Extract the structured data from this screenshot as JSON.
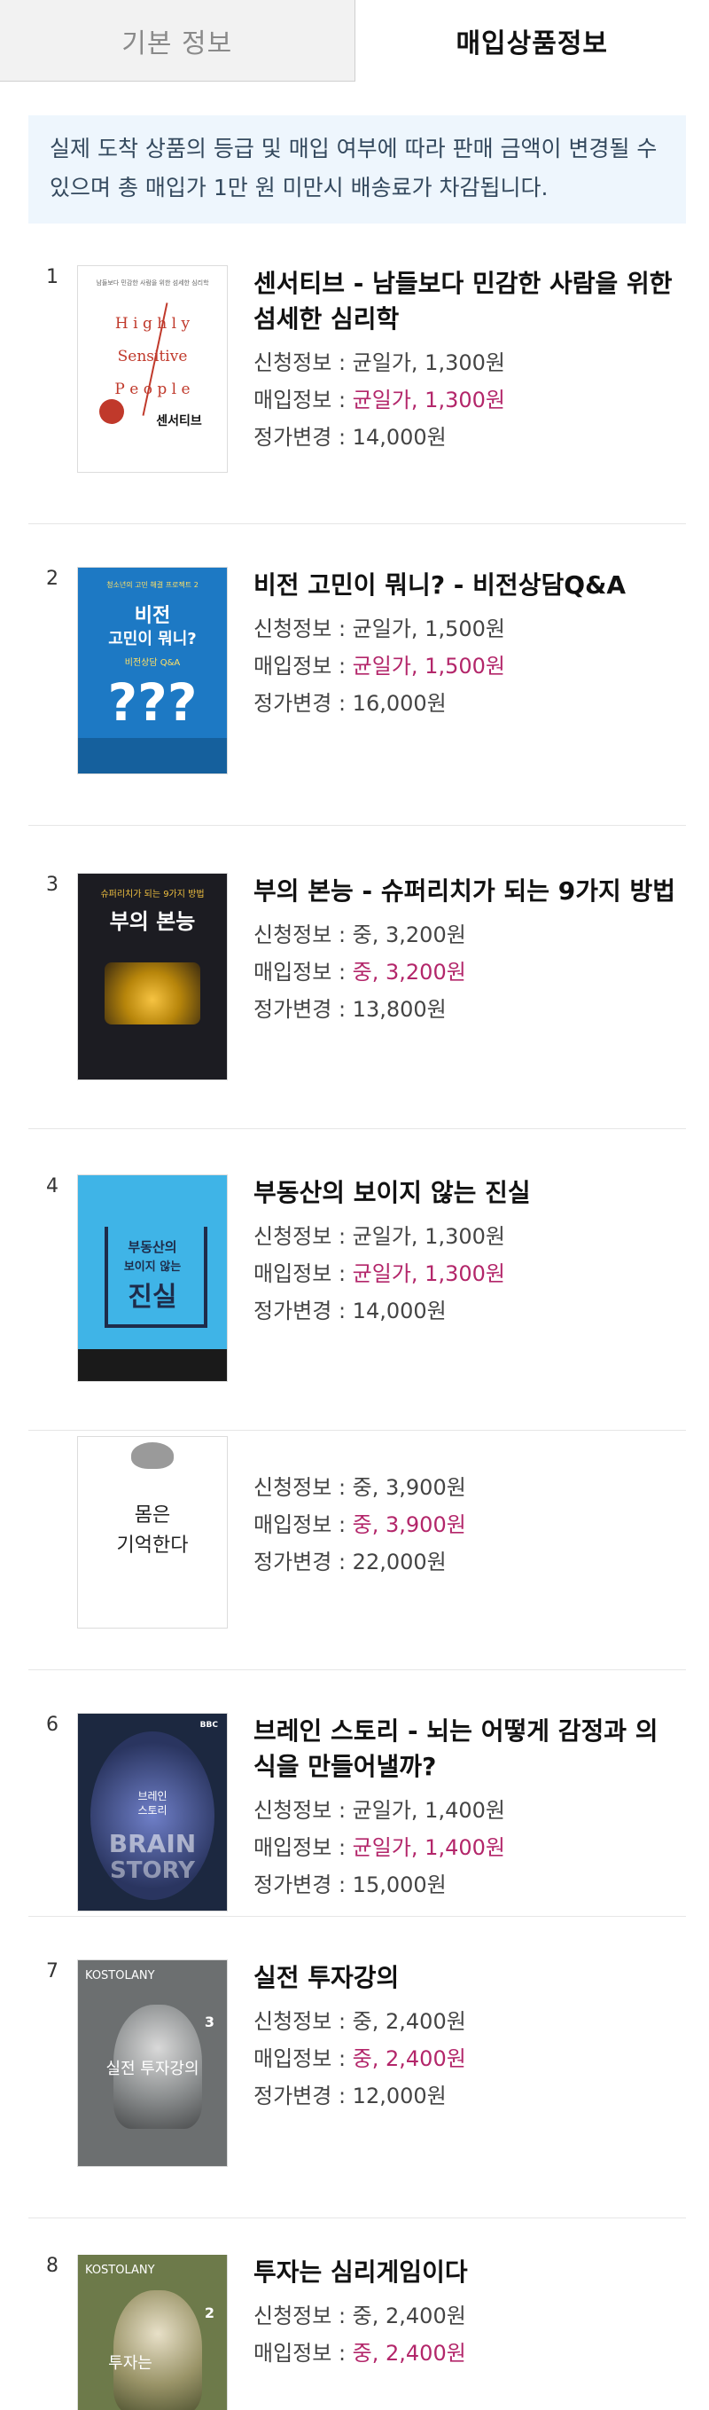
{
  "tabs": [
    {
      "label": "기본 정보"
    },
    {
      "label": "매입상품정보"
    }
  ],
  "notice": "실제 도착 상품의 등급 및 매입 여부에 따라 판매 금액이 변경될 수 있으며 총 매입가 1만 원 미만시 배송료가 차감됩니다.",
  "labels": {
    "request": "신청정보 : ",
    "purchase": "매입정보 : ",
    "price_change": "정가변경 : "
  },
  "items": [
    {
      "num": "1",
      "title": "센서티브 - 남들보다 민감한 사람을 위한 섬세한 심리학",
      "request": "균일가, 1,300원",
      "purchase": "균일가, 1,300원",
      "price": "14,000원",
      "cover": {
        "top": "남들보다 민감한 사람을 위한 섬세한 심리학",
        "lines": [
          "H i g h l y",
          "Sensitive",
          "P e o p l e"
        ],
        "name": "센서티브"
      }
    },
    {
      "num": "2",
      "title": "비전 고민이 뭐니? - 비전상담Q&A",
      "request": "균일가, 1,500원",
      "purchase": "균일가, 1,500원",
      "price": "16,000원",
      "cover": {
        "top": "청소년의 고민 해결 프로젝트 2",
        "lines": [
          "비전",
          "고민이 뭐니?"
        ],
        "name": "비전상담 Q&A"
      }
    },
    {
      "num": "3",
      "title": "부의 본능 - 슈퍼리치가 되는 9가지 방법",
      "request": "중, 3,200원",
      "purchase": "중, 3,200원",
      "price": "13,800원",
      "cover": {
        "top": "슈퍼리치가 되는 9가지 방법",
        "lines": [
          "부의 본능"
        ],
        "name": ""
      }
    },
    {
      "num": "4",
      "title": "부동산의 보이지 않는 진실",
      "request": "균일가, 1,300원",
      "purchase": "균일가, 1,300원",
      "price": "14,000원",
      "cover": {
        "top": "",
        "lines": [
          "부동산의",
          "보이지 않는",
          "진실"
        ],
        "name": ""
      }
    },
    {
      "num": "",
      "title": "",
      "request": "중, 3,900원",
      "purchase": "중, 3,900원",
      "price": "22,000원",
      "cover": {
        "top": "",
        "lines": [
          "몸은",
          "기억한다"
        ],
        "name": ""
      }
    },
    {
      "num": "6",
      "title": "브레인 스토리 - 뇌는 어떻게 감정과 의식을 만들어낼까?",
      "request": "균일가, 1,400원",
      "purchase": "균일가, 1,400원",
      "price": "15,000원",
      "cover": {
        "top": "BBC",
        "lines": [
          "브레인",
          "스토리",
          "BRAIN",
          "STORY"
        ],
        "name": ""
      }
    },
    {
      "num": "7",
      "title": "실전 투자강의",
      "request": "중, 2,400원",
      "purchase": "중, 2,400원",
      "price": "12,000원",
      "cover": {
        "top": "KOSTOLANY",
        "lines": [
          "실전 투자강의"
        ],
        "name": "3"
      }
    },
    {
      "num": "8",
      "title": "투자는 심리게임이다",
      "request": "중, 2,400원",
      "purchase": "중, 2,400원",
      "price": "",
      "cover": {
        "top": "KOSTOLANY",
        "lines": [
          "투자는"
        ],
        "name": "2"
      }
    }
  ]
}
